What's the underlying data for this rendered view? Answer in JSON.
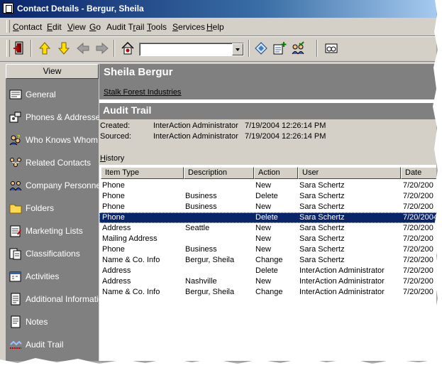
{
  "window": {
    "title": "Contact Details - Bergur, Sheila"
  },
  "menu": [
    "Contact",
    "Edit",
    "View",
    "Go",
    "Audit Trail",
    "Tools",
    "Services",
    "Help"
  ],
  "toolbar": {
    "combo_value": ""
  },
  "sidebar": {
    "header": "View",
    "items": [
      {
        "label": "General",
        "icon": "general-icon"
      },
      {
        "label": "Phones & Addresses",
        "icon": "phones-addresses-icon"
      },
      {
        "label": "Who Knows Whom",
        "icon": "who-knows-whom-icon"
      },
      {
        "label": "Related Contacts",
        "icon": "related-contacts-icon"
      },
      {
        "label": "Company Personnel",
        "icon": "company-personnel-icon"
      },
      {
        "label": "Folders",
        "icon": "folder-icon"
      },
      {
        "label": "Marketing Lists",
        "icon": "marketing-lists-icon"
      },
      {
        "label": "Classifications",
        "icon": "classifications-icon"
      },
      {
        "label": "Activities",
        "icon": "activities-icon"
      },
      {
        "label": "Additional Information",
        "icon": "additional-info-icon"
      },
      {
        "label": "Notes",
        "icon": "notes-icon"
      },
      {
        "label": "Audit Trail",
        "icon": "audit-trail-icon"
      }
    ]
  },
  "contact": {
    "name": "Sheila Bergur",
    "company": "Stalk Forest Industries"
  },
  "audit": {
    "title": "Audit Trail",
    "created_label": "Created:",
    "created_by": "InterAction Administrator",
    "created_at": "7/19/2004 12:26:14 PM",
    "sourced_label": "Sourced:",
    "sourced_by": "InterAction Administrator",
    "sourced_at": "7/19/2004 12:26:14 PM"
  },
  "history": {
    "label_u": "H",
    "label_rest": "istory",
    "columns": [
      "Item Type",
      "Description",
      "Action",
      "User",
      "Date"
    ],
    "selected_index": 3,
    "rows": [
      [
        "Phone",
        "",
        "New",
        "Sara Schertz",
        "7/20/200"
      ],
      [
        "Phone",
        "Business",
        "Delete",
        "Sara Schertz",
        "7/20/200"
      ],
      [
        "Phone",
        "Business",
        "New",
        "Sara Schertz",
        "7/20/200"
      ],
      [
        "Phone",
        "",
        "Delete",
        "Sara Schertz",
        "7/20/2004"
      ],
      [
        "Address",
        "Seattle",
        "New",
        "Sara Schertz",
        "7/20/200"
      ],
      [
        "Mailing Address",
        "",
        "New",
        "Sara Schertz",
        "7/20/200"
      ],
      [
        "Phone",
        "Business",
        "New",
        "Sara Schertz",
        "7/20/200"
      ],
      [
        "Name & Co. Info",
        "Bergur, Sheila",
        "Change",
        "Sara Schertz",
        "7/20/200"
      ],
      [
        "Address",
        "",
        "Delete",
        "InterAction Administrator",
        "7/20/200"
      ],
      [
        "Address",
        "Nashville",
        "New",
        "InterAction Administrator",
        "7/20/200"
      ],
      [
        "Name & Co. Info",
        "Bergur, Sheila",
        "Change",
        "InterAction Administrator",
        "7/20/200"
      ]
    ]
  }
}
